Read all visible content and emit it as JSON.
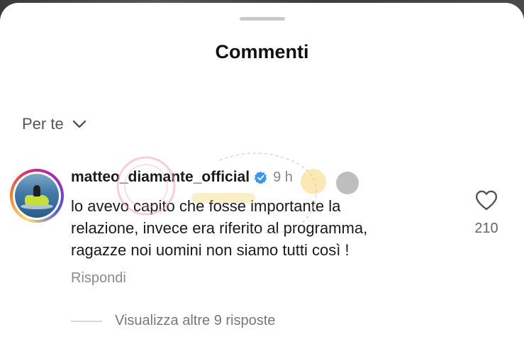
{
  "sheet": {
    "title": "Commenti"
  },
  "filter": {
    "label": "Per te",
    "icon": "chevron-down-icon"
  },
  "comment": {
    "username": "matteo_diamante_official",
    "verified_icon": "verified-badge-icon",
    "time": "9 h",
    "text_lines": [
      "lo avevo capito che fosse importante la",
      "relazione, invece era riferito al programma,",
      "ragazze noi uomini non siamo tutti così !"
    ],
    "reply_label": "Rispondi",
    "like_icon": "heart-icon",
    "like_count": "210"
  },
  "replies": {
    "label": "Visualizza altre 9 risposte"
  },
  "colors": {
    "verified_blue": "#3897f0",
    "text_primary": "#1a1a1a",
    "text_secondary": "#888888"
  }
}
